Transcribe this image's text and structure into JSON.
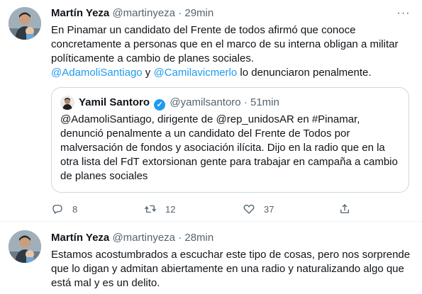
{
  "tweets": [
    {
      "author": "Martín Yeza",
      "handle": "@martinyeza",
      "separator": "·",
      "time": "29min",
      "text": "En Pinamar un candidato del Frente de todos afirmó que conoce concretamente a personas que en el marco de su interna obligan a militar políticamente a cambio de planes sociales.",
      "mention1": "@AdamoliSantiago",
      "conj": " y ",
      "mention2": "@Camilavicmerlo",
      "text_tail": " lo denunciaron penalmente.",
      "more_label": "···",
      "quote": {
        "author": "Yamil Santoro",
        "verified_mark": "✓",
        "handle": "@yamilsantoro",
        "separator": "·",
        "time": "51min",
        "text": "@AdamoliSantiago, dirigente de @rep_unidosAR en #Pinamar, denunció penalmente a un candidato del Frente de Todos por malversación de fondos y asociación ilícita. Dijo en la radio que en la otra lista del FdT extorsionan gente para trabajar en campaña a cambio de planes sociales"
      },
      "actions": {
        "replies": "8",
        "retweets": "12",
        "likes": "37"
      }
    },
    {
      "author": "Martín Yeza",
      "handle": "@martinyeza",
      "separator": "·",
      "time": "28min",
      "text": "Estamos acostumbrados a escuchar este tipo de cosas, pero nos sorprende que lo digan y admitan abiertamente en una radio y naturalizando algo que está mal y es un delito.",
      "more_label": "···"
    }
  ],
  "icons": {
    "reply": "reply-icon",
    "retweet": "retweet-icon",
    "like": "heart-icon",
    "share": "share-icon",
    "more": "more-icon"
  },
  "colors": {
    "link": "#1d9bf0",
    "secondary_text": "#536471",
    "border": "#cfd9de"
  }
}
